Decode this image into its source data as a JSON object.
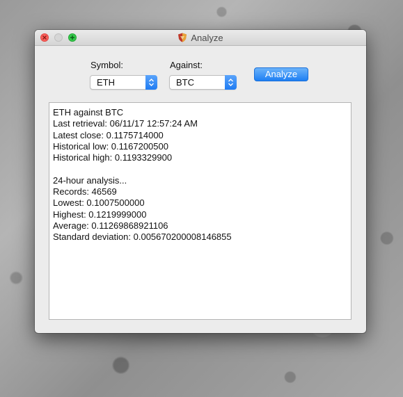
{
  "window": {
    "title": "Analyze"
  },
  "form": {
    "symbol_label": "Symbol:",
    "symbol_value": "ETH",
    "against_label": "Against:",
    "against_value": "BTC",
    "analyze_label": "Analyze"
  },
  "output": {
    "lines": [
      "ETH against BTC",
      "Last retrieval: 06/11/17 12:57:24 AM",
      "Latest close: 0.1175714000",
      "Historical low: 0.1167200500",
      "Historical high: 0.1193329900",
      "",
      "24-hour analysis...",
      "Records: 46569",
      "Lowest: 0.1007500000",
      "Highest: 0.1219999000",
      "Average: 0.11269868921106",
      "Standard deviation: 0.005670200008146855"
    ]
  },
  "colors": {
    "accent": "#1e7ff3",
    "close_button": "#fc605c",
    "zoom_button": "#34c84a"
  },
  "icons": {
    "app": "shield-app-icon",
    "close": "close-icon",
    "minimize": "minimize-icon",
    "zoom": "zoom-icon",
    "popup": "chevron-up-down-icon"
  }
}
